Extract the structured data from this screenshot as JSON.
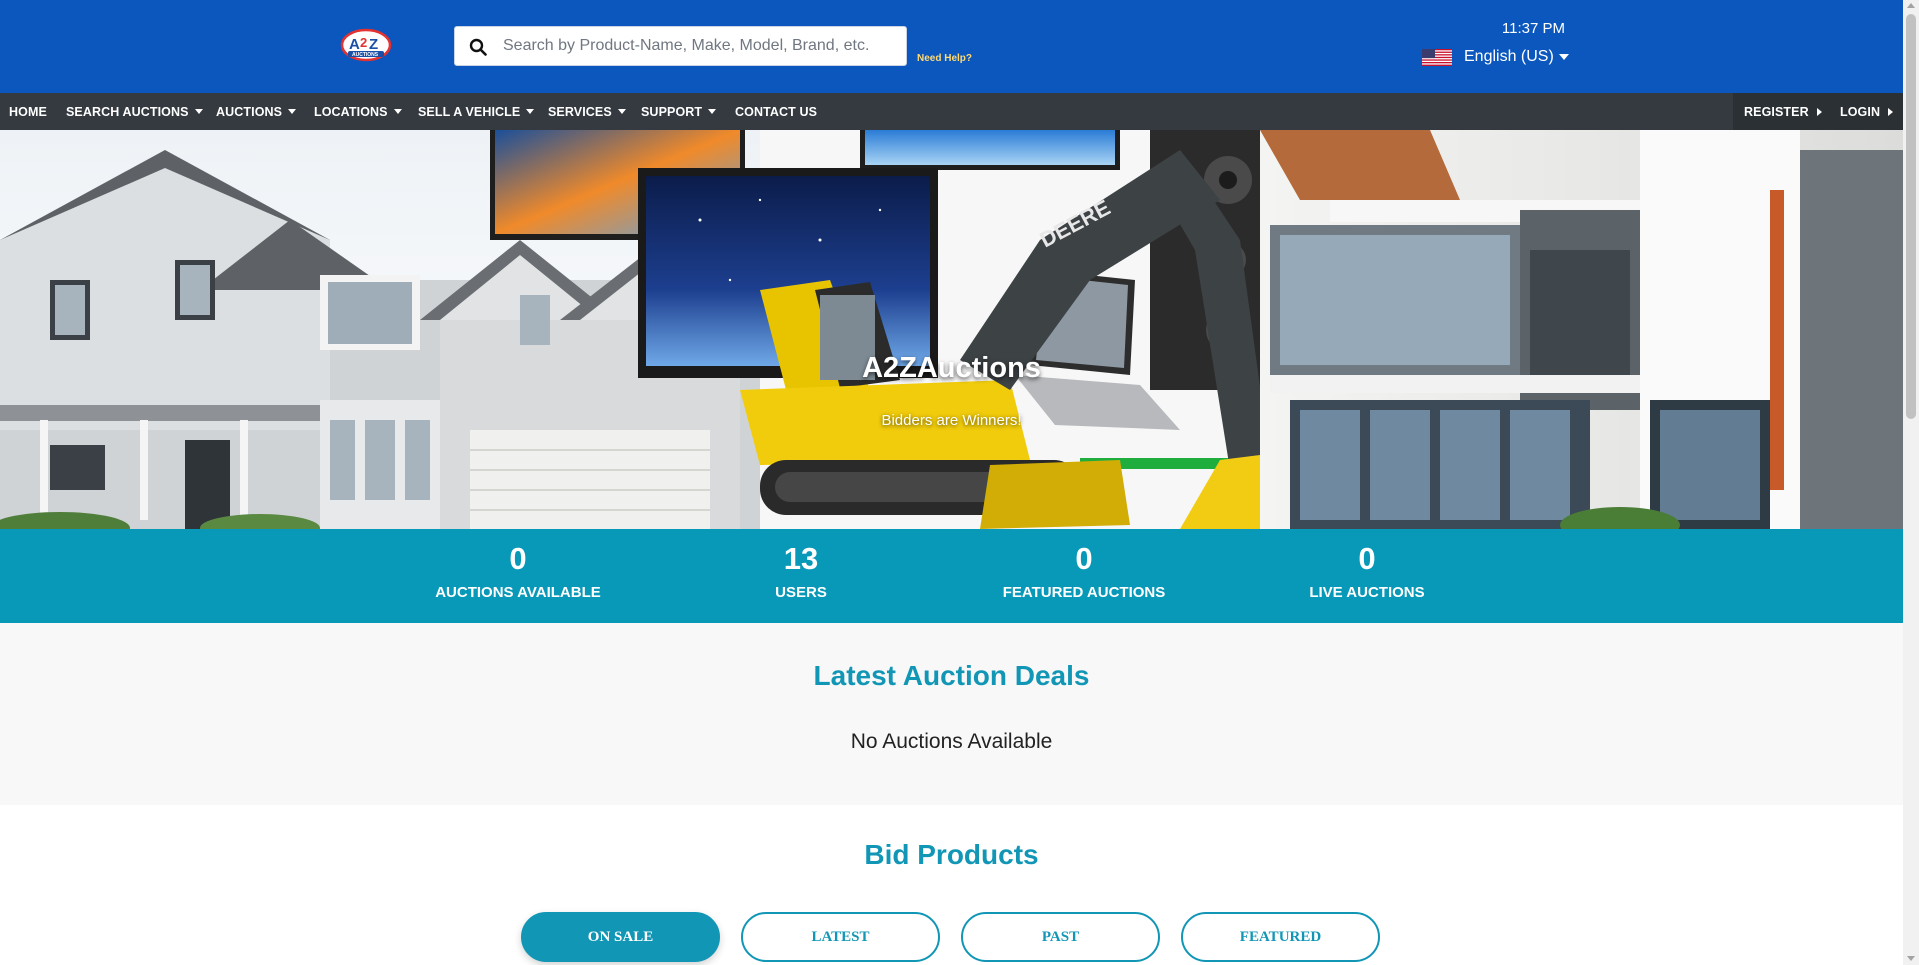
{
  "header": {
    "search_placeholder": "Search by Product-Name, Make, Model, Brand, etc.",
    "need_help": "Need Help?",
    "time": "11:37 PM",
    "language": "English (US)",
    "logo_icon": "a2z-auctions-logo",
    "flag_icon": "us-flag-icon"
  },
  "nav": {
    "items": [
      {
        "label": "HOME"
      },
      {
        "label": "SEARCH AUCTIONS"
      },
      {
        "label": "AUCTIONS"
      },
      {
        "label": "LOCATIONS"
      },
      {
        "label": "SELL A VEHICLE"
      },
      {
        "label": "SERVICES"
      },
      {
        "label": "SUPPORT"
      },
      {
        "label": "CONTACT US"
      }
    ],
    "register": "REGISTER",
    "login": "LOGIN"
  },
  "hero": {
    "title": "A2ZAuctions",
    "subtitle": "Bidders are Winners!",
    "excavator_brand": "DEERE"
  },
  "stats": [
    {
      "value": "0",
      "label": "AUCTIONS AVAILABLE"
    },
    {
      "value": "13",
      "label": "USERS"
    },
    {
      "value": "0",
      "label": "FEATURED AUCTIONS"
    },
    {
      "value": "0",
      "label": "LIVE AUCTIONS"
    }
  ],
  "deals": {
    "title": "Latest Auction Deals",
    "empty_text": "No Auctions Available"
  },
  "bid_products": {
    "title": "Bid Products",
    "tabs": [
      {
        "label": "ON SALE",
        "active": true
      },
      {
        "label": "LATEST",
        "active": false
      },
      {
        "label": "PAST",
        "active": false
      },
      {
        "label": "FEATURED",
        "active": false
      }
    ]
  },
  "colors": {
    "header_blue": "#0b57bd",
    "nav_dark": "#343a40",
    "accent_teal": "#1296b6",
    "stats_teal": "#0999b8"
  }
}
